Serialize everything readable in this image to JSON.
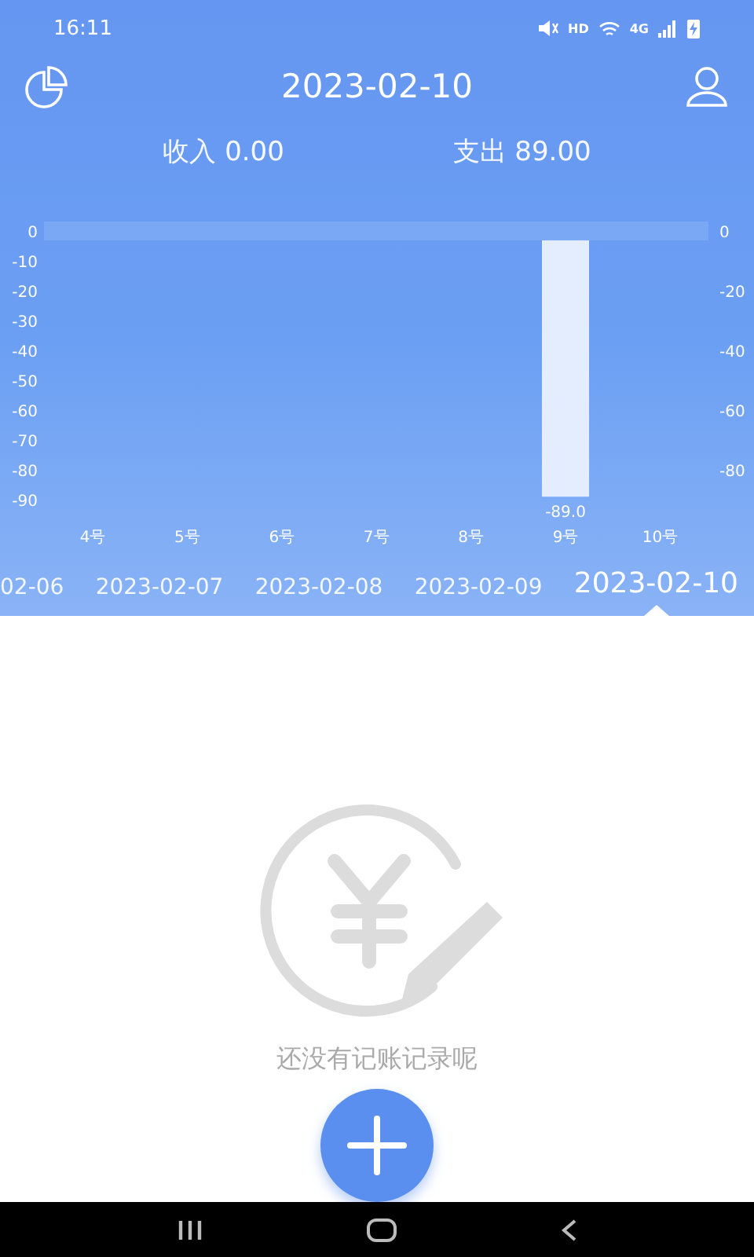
{
  "status_bar": {
    "time": "16:11",
    "network_labels": [
      "HD",
      "4G"
    ]
  },
  "header": {
    "title": "2023-02-10"
  },
  "totals": [
    {
      "label": "收入",
      "amount": "0.00"
    },
    {
      "label": "支出",
      "amount": "89.00"
    }
  ],
  "chart": {
    "right_yticks": [
      "0",
      "-20",
      "-40",
      "-60",
      "-80"
    ],
    "chart_data": {
      "type": "bar",
      "categories": [
        "4号",
        "5号",
        "6号",
        "7号",
        "8号",
        "9号",
        "10号"
      ],
      "series": [
        {
          "color": "#e3edfd",
          "values": [
            0,
            0,
            0,
            0,
            0,
            -89,
            0
          ]
        }
      ],
      "ylim": [
        -90,
        0
      ],
      "yticks": [
        0,
        -10,
        -20,
        -30,
        -40,
        -50,
        -60,
        -70,
        -80,
        -90
      ],
      "annotations": [
        "-89.0"
      ]
    }
  },
  "dates": [
    {
      "label": "02-06",
      "selected": false
    },
    {
      "label": "2023-02-07",
      "selected": false
    },
    {
      "label": "2023-02-08",
      "selected": false
    },
    {
      "label": "2023-02-09",
      "selected": false
    },
    {
      "label": "2023-02-10",
      "selected": true
    }
  ],
  "empty_state": {
    "message": "还没有记账记录呢"
  }
}
